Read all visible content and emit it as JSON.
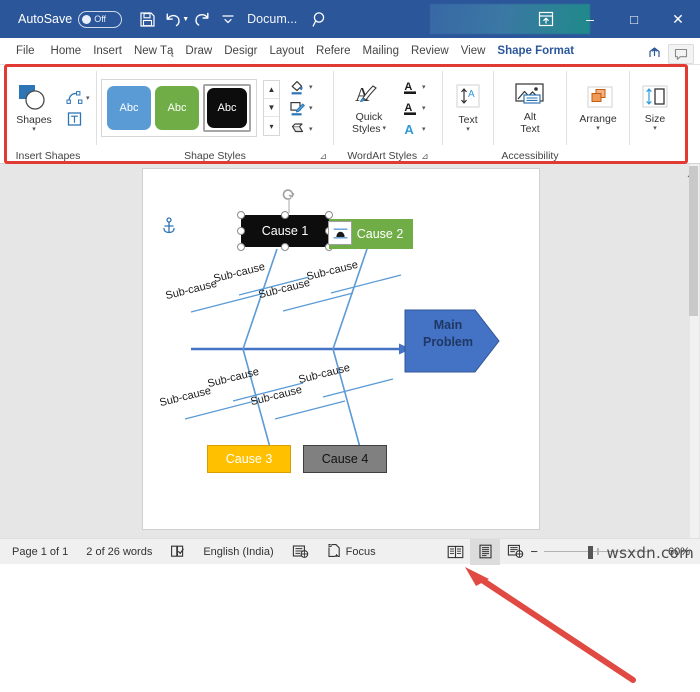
{
  "titlebar": {
    "autosave_label": "AutoSave",
    "autosave_state": "Off",
    "save_icon": "save-icon",
    "undo_icon": "undo-icon",
    "redo_icon": "redo-icon",
    "qat_more_icon": "qat-more-icon",
    "document_name": "Docum...",
    "search_icon": "search-icon",
    "ribbon_display_icon": "ribbon-display-options-icon",
    "minimize_label": "–",
    "maximize_label": "□",
    "close_label": "✕"
  },
  "tabs": [
    {
      "label": "File",
      "active": false
    },
    {
      "label": "Home",
      "active": false
    },
    {
      "label": "Insert",
      "active": false
    },
    {
      "label": "New Tą",
      "active": false
    },
    {
      "label": "Draw",
      "active": false
    },
    {
      "label": "Desigr",
      "active": false
    },
    {
      "label": "Layout",
      "active": false
    },
    {
      "label": "Refere",
      "active": false
    },
    {
      "label": "Mailinɡ",
      "active": false
    },
    {
      "label": "Review",
      "active": false
    },
    {
      "label": "View",
      "active": false
    },
    {
      "label": "Shape Format",
      "active": true
    }
  ],
  "tab_right": {
    "share_icon": "share-icon",
    "comments_icon": "comments-icon"
  },
  "ribbon": {
    "groups": [
      {
        "name": "insert-shapes",
        "label": "Insert Shapes"
      },
      {
        "name": "shape-styles",
        "label": "Shape Styles"
      },
      {
        "name": "wordart-styles",
        "label": "WordArt Styles"
      },
      {
        "name": "accessibility",
        "label": "Accessibility"
      },
      {
        "name": "arrange",
        "label": ""
      },
      {
        "name": "size",
        "label": ""
      }
    ],
    "insert_shapes": {
      "shapes_label": "Shapes",
      "shapes_icon": "shapes-gallery-icon",
      "edit_shape_icon": "edit-shape-icon",
      "text_box_icon": "draw-text-box-icon"
    },
    "shape_styles": {
      "swatches": [
        {
          "caption": "Abc",
          "fill": "#5b9bd5",
          "selected": false
        },
        {
          "caption": "Abc",
          "fill": "#70ad47",
          "selected": false
        },
        {
          "caption": "Abc",
          "fill": "#0d0d0d",
          "selected": true
        }
      ],
      "scroll_up_icon": "gallery-scroll-up-icon",
      "scroll_down_icon": "gallery-scroll-down-icon",
      "more_icon": "gallery-more-icon",
      "shape_fill_icon": "shape-fill-icon",
      "shape_outline_icon": "shape-outline-icon",
      "shape_effects_icon": "shape-effects-icon",
      "dialog_launcher_icon": "dialog-launcher-icon"
    },
    "wordart_styles": {
      "quick_styles_label_1": "Quick",
      "quick_styles_label_2": "Styles",
      "quick_styles_icon": "wordart-quick-styles-icon",
      "text_fill_icon": "text-fill-icon",
      "text_outline_icon": "text-outline-icon",
      "text_effects_icon": "text-effects-icon",
      "dialog_launcher_icon": "dialog-launcher-icon"
    },
    "text_group": {
      "label": "Text",
      "icon": "text-direction-icon"
    },
    "accessibility": {
      "alt_text_label_1": "Alt",
      "alt_text_label_2": "Text",
      "icon": "alt-text-icon"
    },
    "arrange": {
      "label": "Arrange",
      "icon": "arrange-icon"
    },
    "size": {
      "label": "Size",
      "icon": "size-icon"
    },
    "collapse_icon": "collapse-ribbon-icon",
    "highlight_color": "#e03a33"
  },
  "document": {
    "anchor_icon": "object-anchor-icon",
    "layout_options_icon": "layout-options-icon",
    "rotation_handle_icon": "rotation-handle-icon",
    "diagram": {
      "type": "fishbone",
      "main_problem": {
        "label_line1": "Main",
        "label_line2": "Problem",
        "fill": "#4472c4",
        "text_color": "#1f3864"
      },
      "causes": [
        {
          "label": "Cause 1",
          "fill": "#0d0d0d",
          "text_color": "#ffffff",
          "selected": true
        },
        {
          "label": "Cause 2",
          "fill": "#70ad47",
          "text_color": "#ffffff",
          "selected": false
        },
        {
          "label": "Cause 3",
          "fill": "#ffc000",
          "text_color": "#ffffff",
          "selected": false
        },
        {
          "label": "Cause 4",
          "fill": "#808080",
          "text_color": "#000000",
          "selected": false
        }
      ],
      "sub_cause_label": "Sub-cause",
      "sub_cause_count": 8,
      "spine_color": "#4472c4",
      "bone_color": "#5b9bd5"
    },
    "annotation_arrow": {
      "name": "red-callout-arrow",
      "color": "#e04a42"
    }
  },
  "statusbar": {
    "page_label": "Page 1 of 1",
    "word_count": "2 of 26 words",
    "proofing_icon": "proofing-errors-icon",
    "language": "English (India)",
    "accessibility_icon": "accessibility-checker-icon",
    "focus_label": "Focus",
    "focus_icon": "focus-mode-icon",
    "read_mode_icon": "read-mode-icon",
    "print_layout_icon": "print-layout-icon",
    "web_layout_icon": "web-layout-icon",
    "zoom_out_label": "−",
    "zoom_in_label": "+",
    "zoom_value": "60%"
  },
  "watermark": {
    "text": "wsxdn.com"
  }
}
